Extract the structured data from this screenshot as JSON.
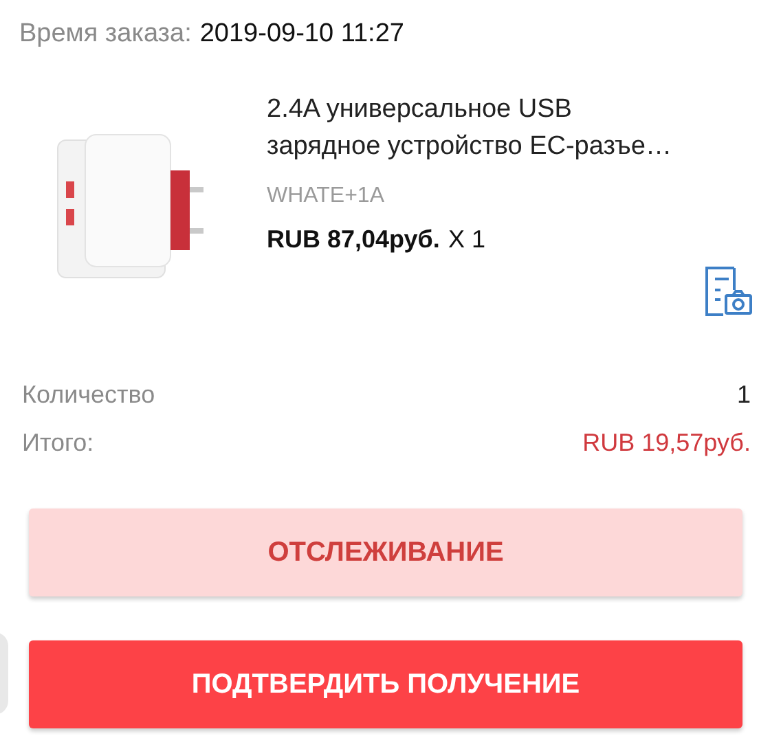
{
  "order_time": {
    "label": "Время заказа:",
    "value": "2019-09-10 11:27"
  },
  "product": {
    "title_lines": [
      "2.4A универсальное USB",
      "зарядное устройство EC-разъе…"
    ],
    "variant": "WHATE+1A",
    "price": "RUB 87,04руб.",
    "quantity": "X 1"
  },
  "summary": [
    {
      "label": "Количество",
      "value": "1",
      "kind": "plain"
    },
    {
      "label": "Итого:",
      "value": "RUB 19,57руб.",
      "kind": "total"
    }
  ],
  "buttons": [
    {
      "label": "ОТСЛЕЖИВАНИЕ",
      "kind": "secondary"
    },
    {
      "label": "ПОДТВЕРДИТЬ ПОЛУЧЕНИЕ",
      "kind": "primary"
    }
  ]
}
